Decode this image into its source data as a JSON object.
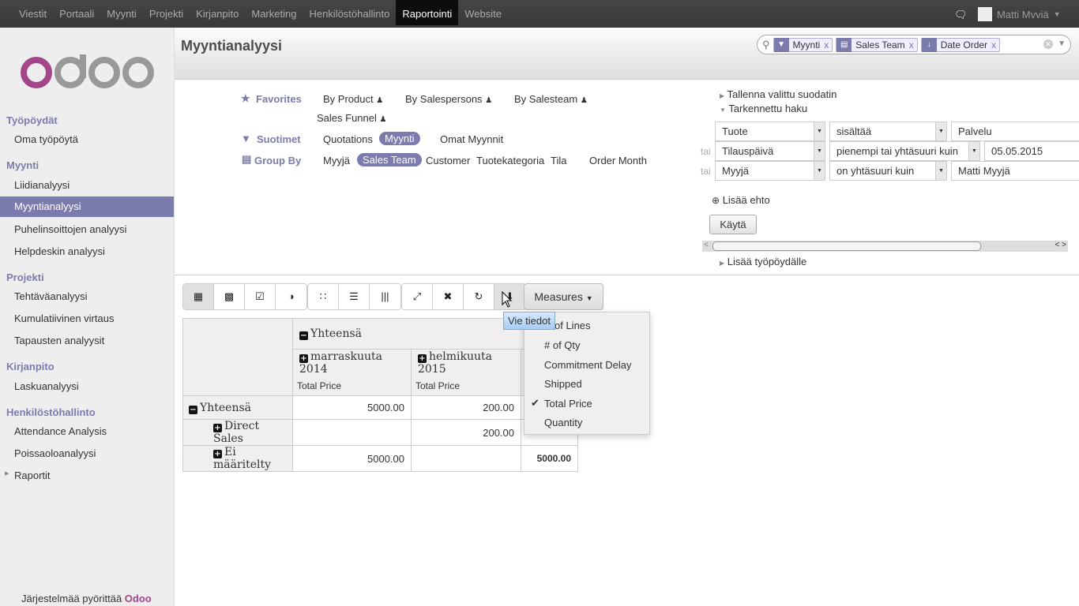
{
  "topbar": {
    "menu": [
      "Viestit",
      "Portaali",
      "Myynti",
      "Projekti",
      "Kirjanpito",
      "Marketing",
      "Henkilöstöhallinto",
      "Raportointi",
      "Website"
    ],
    "active": "Raportointi",
    "user": "Matti Mvviä",
    "chat_icon": "chat-icon"
  },
  "sidebar": {
    "logo": "odoo",
    "sections": [
      {
        "title": "Työpöydät",
        "items": [
          "Oma työpöytä"
        ]
      },
      {
        "title": "Myynti",
        "items": [
          "Liidianalyysi",
          "Myyntianalyysi",
          "Puhelinsoittojen analyysi",
          "Helpdeskin analyysi"
        ]
      },
      {
        "title": "Projekti",
        "items": [
          "Tehtäväanalyysi",
          "Kumulatiivinen virtaus",
          "Tapausten analyysit"
        ]
      },
      {
        "title": "Kirjanpito",
        "items": [
          "Laskuanalyysi"
        ]
      },
      {
        "title": "Henkilöstöhallinto",
        "items": [
          "Attendance Analysis",
          "Poissaoloanalyysi",
          "Raportit"
        ]
      }
    ],
    "active": "Myyntianalyysi",
    "powered_prefix": "Järjestelmää pyörittää",
    "powered_brand": "Odoo"
  },
  "header": {
    "title": "Myyntianalyysi"
  },
  "search": {
    "facets": [
      {
        "icon": "filter-icon",
        "label": "Myynti"
      },
      {
        "icon": "database-icon",
        "label": "Sales Team"
      },
      {
        "icon": "sort-down-icon",
        "label": "Date Order"
      }
    ],
    "remove": "x"
  },
  "filters": {
    "favorites_label": "Favorites",
    "favorites": [
      "By Product",
      "By Salespersons",
      "By Salesteam",
      "Sales Funnel"
    ],
    "filters_label": "Suotimet",
    "filter_items": [
      "Quotations",
      "Myynti",
      "Omat Myynnit"
    ],
    "filter_active": "Myynti",
    "groupby_label": "Group By",
    "groupby_items": [
      "Myyjä",
      "Sales Team",
      "Customer",
      "Tuotekategoria",
      "Tila",
      "Order Month"
    ],
    "groupby_active": "Sales Team"
  },
  "advanced": {
    "save_filter": "Tallenna valittu suodatin",
    "advanced_search": "Tarkennettu haku",
    "or": "tai",
    "conditions": [
      {
        "field": "Tuote",
        "op": "sisältää",
        "value": "Palvelu"
      },
      {
        "field": "Tilauspäivä",
        "op": "pienempi tai yhtäsuuri kuin",
        "value": "05.05.2015"
      },
      {
        "field": "Myyjä",
        "op": "on yhtäsuuri kuin",
        "value": "Matti Myyjä"
      }
    ],
    "add_condition": "Lisää ehto",
    "apply": "Käytä",
    "add_dashboard": "Lisää työpöydälle"
  },
  "toolbar": {
    "measures": "Measures",
    "tooltip": "Vie tiedot"
  },
  "pivot": {
    "col_total": "Yhteensä",
    "cols": [
      "marraskuuta 2014",
      "helmikuuta 2015"
    ],
    "measure": "Total Price",
    "rows": [
      {
        "label": "Yhteensä",
        "values": [
          "5000.00",
          "200.00",
          ""
        ]
      },
      {
        "label": "Direct Sales",
        "values": [
          "",
          "200.00",
          ""
        ]
      },
      {
        "label": "Ei määritelty",
        "values": [
          "5000.00",
          "",
          "5000.00"
        ]
      }
    ]
  },
  "measures_menu": {
    "items": [
      "# of Lines",
      "# of Qty",
      "Commitment Delay",
      "Shipped",
      "Total Price",
      "Quantity"
    ],
    "visible_first": "of Lines",
    "checked": "Total Price"
  }
}
